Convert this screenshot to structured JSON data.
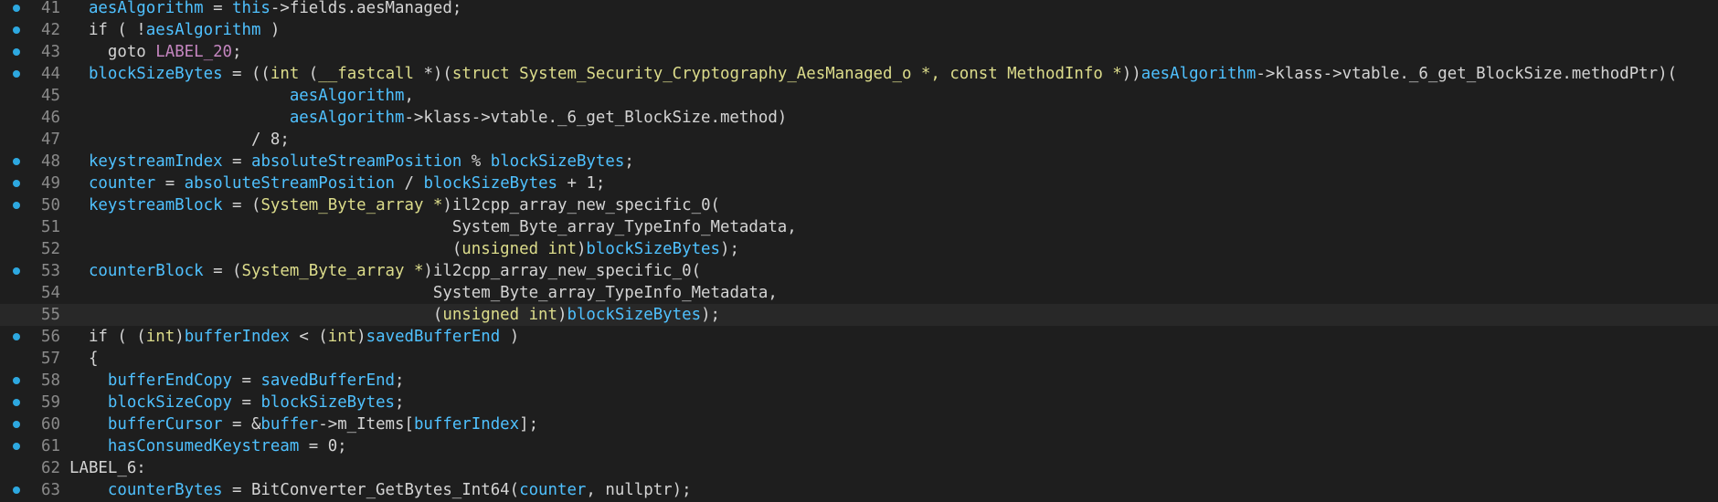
{
  "editor": {
    "colors": {
      "background": "#1e1e1e",
      "current_line": "#282828",
      "breakpoint": "#2da8e0",
      "line_number": "#8a8a8a",
      "variable": "#4fc1ff",
      "type": "#dcdc8b",
      "label": "#c586c0",
      "default_text": "#d4d4d4"
    },
    "lines": [
      {
        "number": "41",
        "breakpoint": true,
        "indent": "  ",
        "tokens": [
          {
            "t": "aesAlgorithm",
            "k": "var"
          },
          {
            "t": " = ",
            "k": "plain"
          },
          {
            "t": "this",
            "k": "var"
          },
          {
            "t": "->fields.aesManaged;",
            "k": "plain"
          }
        ]
      },
      {
        "number": "42",
        "breakpoint": true,
        "indent": "  ",
        "tokens": [
          {
            "t": "if ( !",
            "k": "plain"
          },
          {
            "t": "aesAlgorithm",
            "k": "var"
          },
          {
            "t": " )",
            "k": "plain"
          }
        ]
      },
      {
        "number": "43",
        "breakpoint": true,
        "indent": "    ",
        "tokens": [
          {
            "t": "goto ",
            "k": "plain"
          },
          {
            "t": "LABEL_20",
            "k": "label"
          },
          {
            "t": ";",
            "k": "plain"
          }
        ]
      },
      {
        "number": "44",
        "breakpoint": true,
        "indent": "  ",
        "tokens": [
          {
            "t": "blockSizeBytes",
            "k": "var"
          },
          {
            "t": " = ((",
            "k": "plain"
          },
          {
            "t": "int",
            "k": "type"
          },
          {
            "t": " (",
            "k": "plain"
          },
          {
            "t": "__fastcall",
            "k": "type"
          },
          {
            "t": " *)(",
            "k": "plain"
          },
          {
            "t": "struct System_Security_Cryptography_AesManaged_o *, const MethodInfo *",
            "k": "type"
          },
          {
            "t": "))",
            "k": "plain"
          },
          {
            "t": "aesAlgorithm",
            "k": "var"
          },
          {
            "t": "->klass->vtable._6_get_BlockSize.methodPtr)(",
            "k": "plain"
          }
        ]
      },
      {
        "number": "45",
        "breakpoint": false,
        "indent": "                       ",
        "tokens": [
          {
            "t": "aesAlgorithm",
            "k": "var"
          },
          {
            "t": ",",
            "k": "plain"
          }
        ]
      },
      {
        "number": "46",
        "breakpoint": false,
        "indent": "                       ",
        "tokens": [
          {
            "t": "aesAlgorithm",
            "k": "var"
          },
          {
            "t": "->klass->vtable._6_get_BlockSize.method)",
            "k": "plain"
          }
        ]
      },
      {
        "number": "47",
        "breakpoint": false,
        "indent": "                   ",
        "tokens": [
          {
            "t": "/ 8;",
            "k": "plain"
          }
        ]
      },
      {
        "number": "48",
        "breakpoint": true,
        "indent": "  ",
        "tokens": [
          {
            "t": "keystreamIndex",
            "k": "var"
          },
          {
            "t": " = ",
            "k": "plain"
          },
          {
            "t": "absoluteStreamPosition",
            "k": "var"
          },
          {
            "t": " % ",
            "k": "plain"
          },
          {
            "t": "blockSizeBytes",
            "k": "var"
          },
          {
            "t": ";",
            "k": "plain"
          }
        ]
      },
      {
        "number": "49",
        "breakpoint": true,
        "indent": "  ",
        "tokens": [
          {
            "t": "counter",
            "k": "var"
          },
          {
            "t": " = ",
            "k": "plain"
          },
          {
            "t": "absoluteStreamPosition",
            "k": "var"
          },
          {
            "t": " / ",
            "k": "plain"
          },
          {
            "t": "blockSizeBytes",
            "k": "var"
          },
          {
            "t": " + 1;",
            "k": "plain"
          }
        ]
      },
      {
        "number": "50",
        "breakpoint": true,
        "indent": "  ",
        "tokens": [
          {
            "t": "keystreamBlock",
            "k": "var"
          },
          {
            "t": " = (",
            "k": "plain"
          },
          {
            "t": "System_Byte_array *",
            "k": "type"
          },
          {
            "t": ")il2cpp_array_new_specific_0(",
            "k": "plain"
          }
        ]
      },
      {
        "number": "51",
        "breakpoint": false,
        "indent": "                                        ",
        "tokens": [
          {
            "t": "System_Byte_array_TypeInfo_Metadata,",
            "k": "plain"
          }
        ]
      },
      {
        "number": "52",
        "breakpoint": false,
        "indent": "                                        ",
        "tokens": [
          {
            "t": "(",
            "k": "plain"
          },
          {
            "t": "unsigned int",
            "k": "type"
          },
          {
            "t": ")",
            "k": "plain"
          },
          {
            "t": "blockSizeBytes",
            "k": "var"
          },
          {
            "t": ");",
            "k": "plain"
          }
        ]
      },
      {
        "number": "53",
        "breakpoint": true,
        "indent": "  ",
        "tokens": [
          {
            "t": "counterBlock",
            "k": "var"
          },
          {
            "t": " = (",
            "k": "plain"
          },
          {
            "t": "System_Byte_array *",
            "k": "type"
          },
          {
            "t": ")il2cpp_array_new_specific_0(",
            "k": "plain"
          }
        ]
      },
      {
        "number": "54",
        "breakpoint": false,
        "indent": "                                      ",
        "tokens": [
          {
            "t": "System_Byte_array_TypeInfo_Metadata,",
            "k": "plain"
          }
        ]
      },
      {
        "number": "55",
        "breakpoint": false,
        "indent": "                                      ",
        "current": true,
        "tokens": [
          {
            "t": "(",
            "k": "plain"
          },
          {
            "t": "unsigned int",
            "k": "type"
          },
          {
            "t": ")",
            "k": "plain"
          },
          {
            "t": "blockSizeBytes",
            "k": "var"
          },
          {
            "t": ");",
            "k": "plain"
          }
        ]
      },
      {
        "number": "56",
        "breakpoint": true,
        "indent": "  ",
        "tokens": [
          {
            "t": "if ( (",
            "k": "plain"
          },
          {
            "t": "int",
            "k": "type"
          },
          {
            "t": ")",
            "k": "plain"
          },
          {
            "t": "bufferIndex",
            "k": "var"
          },
          {
            "t": " < (",
            "k": "plain"
          },
          {
            "t": "int",
            "k": "type"
          },
          {
            "t": ")",
            "k": "plain"
          },
          {
            "t": "savedBufferEnd",
            "k": "var"
          },
          {
            "t": " )",
            "k": "plain"
          }
        ]
      },
      {
        "number": "57",
        "breakpoint": false,
        "indent": "  ",
        "tokens": [
          {
            "t": "{",
            "k": "plain"
          }
        ]
      },
      {
        "number": "58",
        "breakpoint": true,
        "indent": "    ",
        "tokens": [
          {
            "t": "bufferEndCopy",
            "k": "var"
          },
          {
            "t": " = ",
            "k": "plain"
          },
          {
            "t": "savedBufferEnd",
            "k": "var"
          },
          {
            "t": ";",
            "k": "plain"
          }
        ]
      },
      {
        "number": "59",
        "breakpoint": true,
        "indent": "    ",
        "tokens": [
          {
            "t": "blockSizeCopy",
            "k": "var"
          },
          {
            "t": " = ",
            "k": "plain"
          },
          {
            "t": "blockSizeBytes",
            "k": "var"
          },
          {
            "t": ";",
            "k": "plain"
          }
        ]
      },
      {
        "number": "60",
        "breakpoint": true,
        "indent": "    ",
        "tokens": [
          {
            "t": "bufferCursor",
            "k": "var"
          },
          {
            "t": " = &",
            "k": "plain"
          },
          {
            "t": "buffer",
            "k": "var"
          },
          {
            "t": "->m_Items[",
            "k": "plain"
          },
          {
            "t": "bufferIndex",
            "k": "var"
          },
          {
            "t": "];",
            "k": "plain"
          }
        ]
      },
      {
        "number": "61",
        "breakpoint": true,
        "indent": "    ",
        "tokens": [
          {
            "t": "hasConsumedKeystream",
            "k": "var"
          },
          {
            "t": " = 0;",
            "k": "plain"
          }
        ]
      },
      {
        "number": "62",
        "breakpoint": false,
        "indent": "",
        "tokens": [
          {
            "t": "LABEL_6:",
            "k": "plain"
          }
        ]
      },
      {
        "number": "63",
        "breakpoint": true,
        "indent": "    ",
        "tokens": [
          {
            "t": "counterBytes",
            "k": "var"
          },
          {
            "t": " = BitConverter_GetBytes_Int64(",
            "k": "plain"
          },
          {
            "t": "counter",
            "k": "var"
          },
          {
            "t": ", nullptr);",
            "k": "plain"
          }
        ]
      }
    ]
  }
}
